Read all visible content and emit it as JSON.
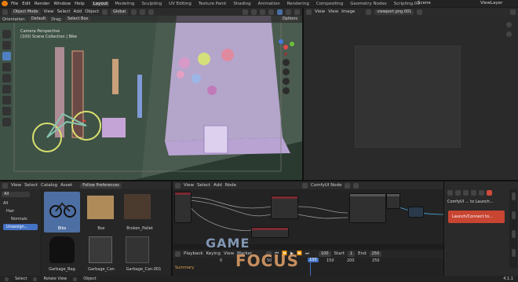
{
  "topbar": {
    "menus": [
      "File",
      "Edit",
      "Render",
      "Window",
      "Help"
    ],
    "workspaces": [
      "Layout",
      "Modeling",
      "Sculpting",
      "UV Editing",
      "Texture Paint",
      "Shading",
      "Animation",
      "Rendering",
      "Compositing",
      "Geometry Nodes",
      "Scripting.00"
    ],
    "active_workspace": "Layout",
    "scene": "Scene",
    "view_layer": "ViewLayer"
  },
  "viewport": {
    "mode": "Object Mode",
    "menus": [
      "View",
      "Select",
      "Add",
      "Object"
    ],
    "transform": "Global",
    "orientation_label": "Orientation:",
    "orientation": "Default",
    "drag_label": "Drag:",
    "drag": "Select Box",
    "options": "Options",
    "overlay_title": "Camera Perspective",
    "overlay_sub": "(100) Scene Collection | Bike"
  },
  "image_editor": {
    "menus": [
      "View",
      "View",
      "Image"
    ],
    "image_name": "viewport.png.001"
  },
  "asset_browser": {
    "menus": [
      "View",
      "Select",
      "Catalog",
      "Asset"
    ],
    "library": "Follow Preferences",
    "filter": "All",
    "tree": [
      "All",
      "Hair",
      "Normals",
      "Unassign..."
    ],
    "assets": [
      "Bike",
      "Box",
      "Broken_Pallet",
      "Garbage_Bag",
      "Garbage_Can",
      "Garbage_Can.001"
    ]
  },
  "node_editor": {
    "menus": [
      "View",
      "Select",
      "Add",
      "Node"
    ],
    "tree_name": "ComfyUI Node"
  },
  "comfy_panel": {
    "title": "ComfyUI ... to Launch...",
    "launch": "Launch/Connect to..."
  },
  "timeline": {
    "menus": [
      "Playback",
      "Keying",
      "View",
      "Marker"
    ],
    "current_frame": "100",
    "start_label": "Start",
    "start": "1",
    "end_label": "End",
    "end": "250",
    "ticks": [
      "0",
      "50",
      "100",
      "150",
      "200",
      "250"
    ],
    "summary": "Summary"
  },
  "statusbar": {
    "select": "Select",
    "rotate": "Rotate View",
    "object": "Object",
    "version": "4.1.1"
  },
  "watermark": {
    "line1": "GAME",
    "line2": "FOCUS"
  }
}
